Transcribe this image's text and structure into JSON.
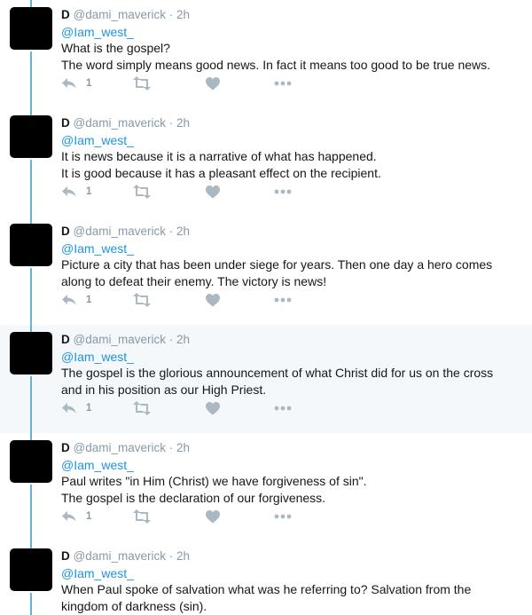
{
  "tweets": [
    {
      "name": "D",
      "handle": "@dami_maverick",
      "separator": "·",
      "time": "2h",
      "mention": "@Iam_west_",
      "lines": [
        "What is the gospel?",
        "The word simply means good news. In fact it means too good to be true news."
      ],
      "reply_count": "1"
    },
    {
      "name": "D",
      "handle": "@dami_maverick",
      "separator": "·",
      "time": "2h",
      "mention": "@Iam_west_",
      "lines": [
        "It is news because it is a narrative of what has happened.",
        "It is good because it has a pleasant effect on the recipient."
      ],
      "reply_count": "1"
    },
    {
      "name": "D",
      "handle": "@dami_maverick",
      "separator": "·",
      "time": "2h",
      "mention": "@Iam_west_",
      "lines": [
        "Picture a city that has been under siege for years. Then one day a hero comes",
        "along to defeat their enemy. The victory is news!"
      ],
      "reply_count": "1"
    },
    {
      "name": "D",
      "handle": "@dami_maverick",
      "separator": "·",
      "time": "2h",
      "mention": "@Iam_west_",
      "lines": [
        "The gospel is the glorious announcement of what Christ did for us on the cross",
        "and in his position as our High Priest."
      ],
      "reply_count": "1"
    },
    {
      "name": "D",
      "handle": "@dami_maverick",
      "separator": "·",
      "time": "2h",
      "mention": "@Iam_west_",
      "lines": [
        "Paul writes \"in Him (Christ) we have forgiveness of sin\".",
        "The gospel is the declaration of our forgiveness."
      ],
      "reply_count": "1"
    },
    {
      "name": "D",
      "handle": "@dami_maverick",
      "separator": "·",
      "time": "2h",
      "mention": "@Iam_west_",
      "lines": [
        "When Paul spoke of salvation what was he referring to? Salvation from the",
        "kingdom of darkness (sin)."
      ],
      "reply_count": ""
    }
  ],
  "colors": {
    "thread_line": "#67b3d6",
    "mention": "#1b95e0",
    "meta": "#8899a6",
    "icon": "#aab8c2",
    "highlight_bg": "#f5f8fa"
  }
}
